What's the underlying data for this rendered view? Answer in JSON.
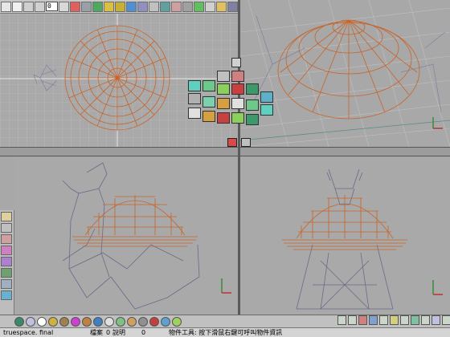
{
  "toolbar": {
    "frame_value": "0",
    "left_buttons": [
      "viewport-button",
      "help-button",
      "play-button",
      "rewind-button",
      "frame-field",
      "next-frame-button",
      "end-button",
      "list-button",
      "cube-tool-button",
      "paint-tool-button",
      "move-tool-button",
      "rotate-tool-button",
      "scale-tool-button",
      "grid-tool-button",
      "pen-tool-button",
      "camera-tool-button",
      "light-tool-button",
      "render-button"
    ]
  },
  "palette": {
    "colors": [
      "#5fd0c0",
      "#6cc98a",
      "#8cd05c",
      "#d6a040",
      "#7bd0ae",
      "#c84040",
      "#3c9a6a",
      "#b0b0b0",
      "#e0e0e0",
      "#5cb0c8"
    ]
  },
  "status": {
    "scene_name": "truespace. final",
    "file_label": "檔案",
    "file_value": "0",
    "desc_label": "說明",
    "desc_value": "0",
    "object_tool_text": "物件工具: 按下滑鼠右鍵可呼叫物件資訊"
  },
  "colors": {
    "wire_orange": "#c8642a",
    "wire_gray": "#6a6a8a",
    "grid": "#c4c4c4",
    "viewport_bg": "#a8a8a8"
  }
}
